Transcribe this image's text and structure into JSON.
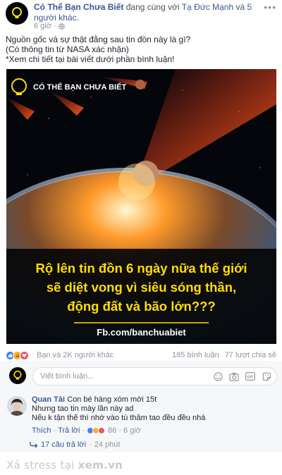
{
  "post": {
    "page_name": "Có Thể Bạn Chưa Biết",
    "with_text": "đang cùng với",
    "tagged_person": "Tạ Đức Mạnh",
    "and_text": "và",
    "others": "5 người khác.",
    "time": "6 giờ",
    "audience_icon": "globe-icon",
    "text_lines": [
      "Nguồn gốc và sự thật đằng sau tin đồn này là gì?",
      "(Có thông tin từ NASA xác nhận)",
      "*Xem chi tiết tại bài viết dưới phần bình luận!"
    ]
  },
  "image": {
    "brand": "CÓ THỂ BẠN CHƯA BIẾT",
    "headline_lines": [
      "Rộ lên tin đồn 6 ngày nữa thế giới",
      "sẽ diệt vong vì siêu sóng thần,",
      "động đất và bão lớn???"
    ],
    "url": "Fb.com/banchuabiet",
    "accent_color": "#ffde00"
  },
  "reactions": {
    "icons": [
      "like-icon",
      "haha-icon",
      "love-icon"
    ],
    "count_text": "Bạn và 2K người khác",
    "comments": "185 bình luận",
    "shares": "77 lượt chia sẻ"
  },
  "composer": {
    "placeholder": "Viết bình luận..."
  },
  "comment": {
    "author": "Quan Tài",
    "line1": "Con bé hàng xóm mới 15t",
    "line2": "Nhưng tao tin mày lần này ad",
    "line3": "Nếu k tận thế thì nhớ vào tù thăm tao đều đều nhá",
    "like_label": "Thích",
    "reply_label": "Trả lời",
    "reaction_count": "86",
    "time": "6 giờ",
    "replies_text": "17 câu trả lời",
    "replies_time": "24 phút"
  },
  "watermark": {
    "prefix": "Xả stress tại",
    "site": "xem.vn"
  }
}
